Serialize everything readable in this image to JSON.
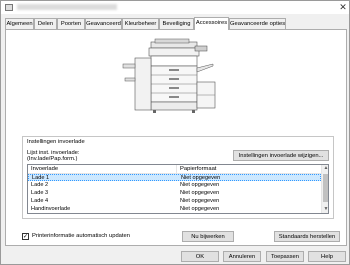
{
  "window": {
    "title": "",
    "close_glyph": "✕"
  },
  "tabs": [
    {
      "label": "Algemeen"
    },
    {
      "label": "Delen"
    },
    {
      "label": "Poorten"
    },
    {
      "label": "Geavanceerd"
    },
    {
      "label": "Kleurbeheer"
    },
    {
      "label": "Beveiliging"
    },
    {
      "label": "Accessoires"
    },
    {
      "label": "Geavanceerde opties"
    }
  ],
  "active_tab_index": 6,
  "input_tray": {
    "group_title": "Instellingen invoerlade",
    "list_label_line1": "Lijst inst. invoerlade:",
    "list_label_line2": "(Inv.lade/Pap.form.)",
    "change_button": "Instellingen invoerlade wijzigen...",
    "columns": [
      "Invoerlade",
      "Papierformaat"
    ],
    "rows": [
      {
        "tray": "Lade 1",
        "size": "Niet opgegeven"
      },
      {
        "tray": "Lade 2",
        "size": "Niet opgegeven"
      },
      {
        "tray": "Lade 3",
        "size": "Niet opgegeven"
      },
      {
        "tray": "Lade 4",
        "size": "Niet opgegeven"
      },
      {
        "tray": "Handinvoerlade",
        "size": "Niet opgegeven"
      }
    ],
    "selected_row": 0
  },
  "auto_update": {
    "label": "Printerinformatie automatisch updaten",
    "checked": true,
    "check_glyph": "✓"
  },
  "buttons": {
    "update_now": "Nu bijwerken",
    "restore_defaults": "Standaards herstellen",
    "ok": "OK",
    "cancel": "Annuleren",
    "apply": "Toepassen",
    "help": "Help"
  },
  "colors": {
    "selection": "#cce8ff",
    "selection_border": "#3399ff",
    "dialog_bg": "#f0f0f0"
  }
}
